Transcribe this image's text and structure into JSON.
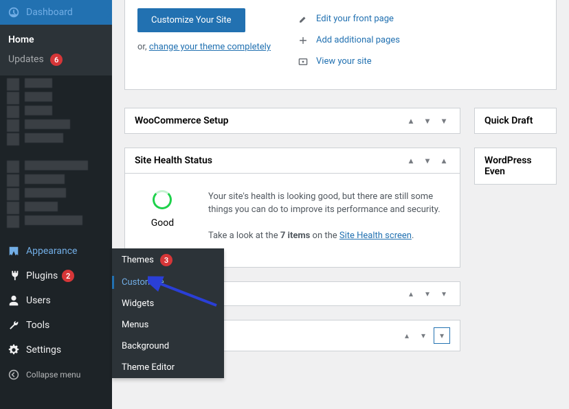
{
  "sidebar": {
    "dashboard": "Dashboard",
    "home": "Home",
    "updates": "Updates",
    "updates_count": "6",
    "appearance": "Appearance",
    "plugins": "Plugins",
    "plugins_count": "2",
    "users": "Users",
    "tools": "Tools",
    "settings": "Settings",
    "collapse": "Collapse menu"
  },
  "submenu": {
    "themes": "Themes",
    "themes_count": "3",
    "customize": "Customize",
    "widgets": "Widgets",
    "menus": "Menus",
    "background": "Background",
    "theme_editor": "Theme Editor"
  },
  "top": {
    "customize_btn": "Customize Your Site",
    "or_prefix": "or, ",
    "change_theme": "change your theme completely",
    "edit_front": "Edit your front page",
    "add_pages": "Add additional pages",
    "view_site": "View your site"
  },
  "panels": {
    "woo_setup": "WooCommerce Setup",
    "quick_draft": "Quick Draft",
    "site_health": "Site Health Status",
    "wp_events": "WordPress Even",
    "health_label": "Good",
    "health_p1": "Your site's health is looking good, but there are still some things you can do to improve its performance and security.",
    "health_p2a": "Take a look at the ",
    "health_p2b": "7 items",
    "health_p2c": " on the ",
    "health_link": "Site Health screen",
    "health_p2d": "."
  }
}
